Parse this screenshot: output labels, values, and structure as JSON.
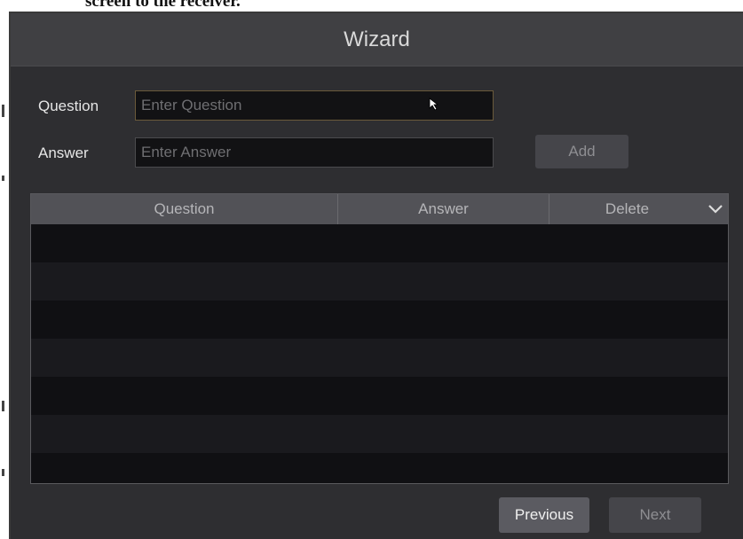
{
  "window": {
    "title": "Wizard",
    "top_fragment": "screen to the receiver."
  },
  "form": {
    "question_label": "Question",
    "question_placeholder": "Enter Question",
    "answer_label": "Answer",
    "answer_placeholder": "Enter Answer",
    "add_label": "Add"
  },
  "table": {
    "columns": [
      "Question",
      "Answer",
      "Delete"
    ],
    "rows": []
  },
  "footer": {
    "previous_label": "Previous",
    "next_label": "Next"
  },
  "icons": {
    "dropdown": "chevron-down-icon",
    "cursor": "mouse-pointer-icon"
  },
  "colors": {
    "dialog_bg": "#2e2e31",
    "titlebar_bg": "#404043",
    "header_bg": "#525257",
    "row_even": "#1a1a1e",
    "row_odd": "#101013",
    "active_button": "#5b5b61"
  }
}
